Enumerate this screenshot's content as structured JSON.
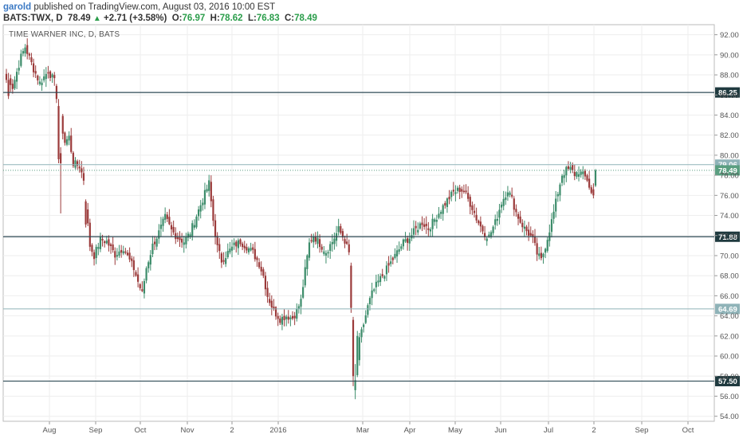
{
  "header": {
    "username": "garold",
    "published_text": "published on TradingView.com, August 03, 2016 10:00 EST",
    "symbol_interval": "BATS:TWX, D",
    "last_price": "78.49",
    "change_arrow": "▲",
    "change": "+2.71 (+3.58%)",
    "open_label": "O:",
    "open": "76.97",
    "high_label": "H:",
    "high": "78.62",
    "low_label": "L:",
    "low": "76.83",
    "close_label": "C:",
    "close": "78.49"
  },
  "colors": {
    "up": "#3c8c6a",
    "down": "#9b3a3a",
    "line_dark": "#2e4a55",
    "line_light": "#8fb3b8",
    "grid": "#eeeeee",
    "last_price_label": "#5a9e80"
  },
  "chart_data": {
    "type": "candlestick",
    "title": "TIME WARNER INC, D, BATS",
    "ylim": [
      53.5,
      93
    ],
    "y_ticks": [
      "54.00",
      "56.00",
      "58.00",
      "60.00",
      "62.00",
      "64.00",
      "66.00",
      "68.00",
      "70.00",
      "72.00",
      "74.00",
      "76.00",
      "78.00",
      "80.00",
      "82.00",
      "84.00",
      "86.00",
      "88.00",
      "90.00",
      "92.00"
    ],
    "x_ticks": [
      "Aug",
      "Sep",
      "Oct",
      "Nov",
      "2",
      "2016",
      "Mar",
      "Apr",
      "May",
      "Jun",
      "Jul",
      "2",
      "Sep",
      "Oct"
    ],
    "horizontal_levels": [
      {
        "value": 86.25,
        "label": "86.25",
        "style": "dark"
      },
      {
        "value": 79.06,
        "label": "79.06",
        "style": "light"
      },
      {
        "value": 71.88,
        "label": "71.88",
        "style": "dark"
      },
      {
        "value": 64.69,
        "label": "64.69",
        "style": "light"
      },
      {
        "value": 57.5,
        "label": "57.50",
        "style": "dark"
      }
    ],
    "last_price": {
      "value": 78.49,
      "label": "78.49"
    },
    "anchors": [
      [
        0,
        88.3
      ],
      [
        3,
        86.8
      ],
      [
        7,
        89.8
      ],
      [
        9,
        90.8
      ],
      [
        13,
        88.6
      ],
      [
        16,
        87.2
      ],
      [
        20,
        88.4
      ],
      [
        22,
        87.7
      ],
      [
        24,
        86.9
      ],
      [
        25,
        84.6
      ],
      [
        28,
        81.3
      ],
      [
        30,
        81.8
      ],
      [
        32,
        79.2
      ],
      [
        35,
        78.9
      ],
      [
        37,
        77.6
      ],
      [
        38,
        75.0
      ],
      [
        40,
        71.0
      ],
      [
        42,
        70.0
      ],
      [
        45,
        71.6
      ],
      [
        48,
        71.4
      ],
      [
        52,
        70.1
      ],
      [
        56,
        70.8
      ],
      [
        58,
        69.9
      ],
      [
        61,
        68.7
      ],
      [
        63,
        67.4
      ],
      [
        65,
        66.2
      ],
      [
        67,
        68.8
      ],
      [
        70,
        71.0
      ],
      [
        73,
        72.3
      ],
      [
        76,
        73.8
      ],
      [
        79,
        72.5
      ],
      [
        82,
        71.8
      ],
      [
        85,
        71.4
      ],
      [
        88,
        72.3
      ],
      [
        91,
        74.0
      ],
      [
        94,
        75.6
      ],
      [
        97,
        77.2
      ],
      [
        99,
        73.5
      ],
      [
        101,
        70.8
      ],
      [
        103,
        69.5
      ],
      [
        106,
        70.3
      ],
      [
        109,
        71.0
      ],
      [
        112,
        71.4
      ],
      [
        115,
        70.9
      ],
      [
        118,
        70.3
      ],
      [
        121,
        69.2
      ],
      [
        123,
        68.0
      ],
      [
        125,
        66.0
      ],
      [
        128,
        64.5
      ],
      [
        131,
        63.7
      ],
      [
        134,
        64.0
      ],
      [
        137,
        63.8
      ],
      [
        139,
        64.5
      ],
      [
        141,
        65.5
      ],
      [
        143,
        68.5
      ],
      [
        145,
        71.2
      ],
      [
        147,
        72.0
      ],
      [
        150,
        71.2
      ],
      [
        153,
        70.4
      ],
      [
        156,
        71.4
      ],
      [
        159,
        72.6
      ],
      [
        162,
        71.5
      ],
      [
        164,
        70.2
      ],
      [
        165,
        66.0
      ],
      [
        166,
        63.0
      ],
      [
        167,
        57.0
      ],
      [
        168,
        59.8
      ],
      [
        169,
        61.5
      ],
      [
        171,
        63.2
      ],
      [
        173,
        64.9
      ],
      [
        175,
        66.2
      ],
      [
        178,
        67.4
      ],
      [
        181,
        68.3
      ],
      [
        184,
        69.3
      ],
      [
        187,
        70.3
      ],
      [
        190,
        71.3
      ],
      [
        193,
        71.8
      ],
      [
        196,
        72.6
      ],
      [
        199,
        73.3
      ],
      [
        202,
        72.7
      ],
      [
        205,
        73.6
      ],
      [
        208,
        74.6
      ],
      [
        211,
        75.5
      ],
      [
        214,
        76.3
      ],
      [
        217,
        76.6
      ],
      [
        219,
        76.4
      ],
      [
        221,
        75.6
      ],
      [
        223,
        74.8
      ],
      [
        225,
        73.7
      ],
      [
        227,
        72.9
      ],
      [
        229,
        72.2
      ],
      [
        231,
        71.9
      ],
      [
        234,
        73.3
      ],
      [
        237,
        75.3
      ],
      [
        240,
        76.6
      ],
      [
        242,
        75.6
      ],
      [
        244,
        74.3
      ],
      [
        246,
        73.4
      ],
      [
        248,
        72.7
      ],
      [
        250,
        72.2
      ],
      [
        252,
        71.6
      ],
      [
        254,
        70.2
      ],
      [
        256,
        69.5
      ],
      [
        258,
        71.0
      ],
      [
        260,
        72.6
      ],
      [
        262,
        74.3
      ],
      [
        264,
        76.3
      ],
      [
        266,
        78.1
      ],
      [
        268,
        78.5
      ],
      [
        270,
        78.6
      ],
      [
        272,
        78.1
      ],
      [
        274,
        78.4
      ],
      [
        276,
        78.0
      ],
      [
        278,
        77.6
      ],
      [
        280,
        76.2
      ],
      [
        281,
        76.97
      ],
      [
        282,
        78.49
      ]
    ],
    "special_bars": [
      {
        "i": 0,
        "open": 88.1,
        "high": 88.6,
        "low": 87.2,
        "close": 87.5
      },
      {
        "i": 1,
        "open": 87.5,
        "high": 88.2,
        "low": 85.6,
        "close": 85.9
      },
      {
        "i": 24,
        "open": 86.9,
        "high": 87.1,
        "low": 85.2,
        "close": 85.6
      },
      {
        "i": 25,
        "open": 84.9,
        "high": 85.6,
        "low": 79.2,
        "close": 79.6
      },
      {
        "i": 26,
        "open": 80.2,
        "high": 80.8,
        "low": 74.2,
        "close": 79.2
      },
      {
        "i": 38,
        "open": 75.4,
        "high": 75.6,
        "low": 72.8,
        "close": 73.1
      },
      {
        "i": 165,
        "open": 69.0,
        "high": 69.3,
        "low": 64.3,
        "close": 64.8
      },
      {
        "i": 166,
        "open": 63.6,
        "high": 63.9,
        "low": 57.0,
        "close": 58.0
      },
      {
        "i": 167,
        "open": 56.6,
        "high": 59.2,
        "low": 55.7,
        "close": 57.6
      },
      {
        "i": 168,
        "open": 58.1,
        "high": 62.5,
        "low": 57.9,
        "close": 62.0
      },
      {
        "i": 281,
        "open": 76.6,
        "high": 77.2,
        "low": 75.7,
        "close": 76.0
      },
      {
        "i": 282,
        "open": 76.97,
        "high": 78.62,
        "low": 76.83,
        "close": 78.49
      }
    ]
  }
}
